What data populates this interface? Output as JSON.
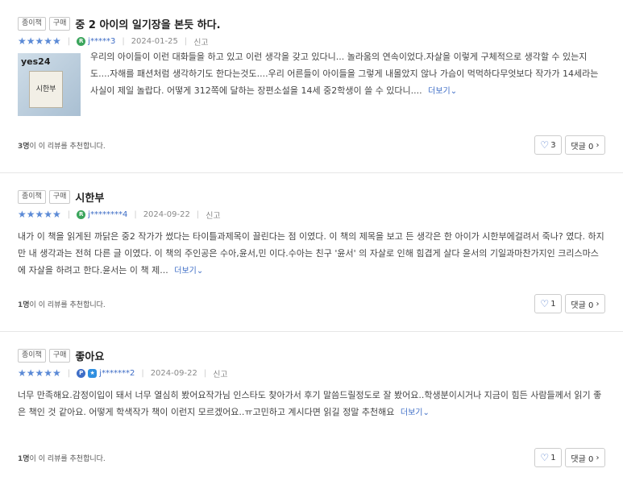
{
  "reviews": [
    {
      "tags": [
        "종이책",
        "구매"
      ],
      "title": "중 2 아이의 일기장을 본듯 하다.",
      "stars": "★★★★★",
      "badge": "R",
      "user": "j*****3",
      "date": "2024-01-25",
      "report": "신고",
      "thumb_logo": "yes24",
      "thumb_title": "시한부",
      "body": "우리의 아이들이 이런 대화들을 하고 있고 이런 생각을 갖고 있다니... 놀라움의 연속이었다.자살을 이렇게 구체적으로 생각할 수 있는지도....자해를 패션처럼 생각하기도 한다는것도....우리 어른들이 아이들을 그렇게 내몰았지 않나 가슴이 먹먹하다무엇보다 작가가 14세라는 사실이 제일 놀랍다. 어떻게 312쪽에 달하는 장편소설을 14세 중2학생이 쓸 수 있다니....",
      "more": "더보기",
      "recommend_count": "3명",
      "recommend_text": "이 이 리뷰를 추천합니다.",
      "likes": "3",
      "comments": "댓글 0"
    },
    {
      "tags": [
        "종이책",
        "구매"
      ],
      "title": "시한부",
      "stars": "★★★★★",
      "badge": "R",
      "user": "j********4",
      "date": "2024-09-22",
      "report": "신고",
      "body": "내가 이 책을 읽게된 까닭은 중2 작가가 썼다는 타이틀과제목이 끌린다는 점 이였다. 이 책의 제목을 보고 든 생각은 한 아이가 시한부에걸려서 죽나? 였다. 하지만 내 생각과는 전혀 다른 글 이였다. 이 책의 주인공은 수아,윤서,민 이다.수아는 친구 '윤서' 의 자살로 인해 힘겹게 살다 윤서의 기일과마찬가지인 크리스마스에 자살을 하려고 한다.윤서는 이 책 제...",
      "more": "더보기",
      "recommend_count": "1명",
      "recommend_text": "이 이 리뷰를 추천합니다.",
      "likes": "1",
      "comments": "댓글 0"
    },
    {
      "tags": [
        "종이책",
        "구매"
      ],
      "title": "좋아요",
      "stars": "★★★★★",
      "badge": "P",
      "user": "j*******2",
      "date": "2024-09-22",
      "report": "신고",
      "body": "너무 만족해요.감정이입이 돼서 너무 열심히 봤어요작가님 인스타도 찾아가서 후기 말씀드릴정도로 잘 봤어요..학생분이시거나 지금이 힘든 사람들께서 읽기 좋은 책인 것 같아요. 어떻게 학색작가 책이 이런지 모르겠어요..ㅠ고민하고 계시다면 읽길 정말 추천해요",
      "more": "더보기",
      "recommend_count": "1명",
      "recommend_text": "이 이 리뷰를 추천합니다.",
      "likes": "1",
      "comments": "댓글 0"
    }
  ],
  "colors": {
    "accent": "#3e6dc6",
    "star": "#5b8ad6",
    "badge_green": "#3ba55c"
  },
  "icons": {
    "heart": "heart-icon",
    "chevron": "chevron-right-icon",
    "more": "chevron-down-icon"
  }
}
